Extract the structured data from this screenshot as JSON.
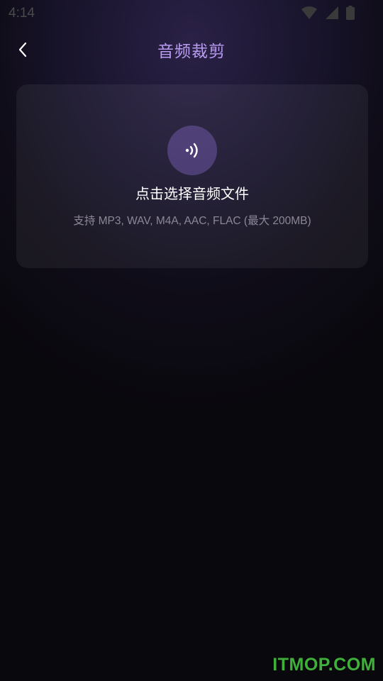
{
  "status_bar": {
    "time": "4:14",
    "icons": [
      "wifi-icon",
      "cell-signal-icon",
      "battery-icon"
    ]
  },
  "header": {
    "back_icon": "chevron-left-icon",
    "title": "音频裁剪"
  },
  "upload": {
    "icon": "audio-wave-icon",
    "title": "点击选择音频文件",
    "subtitle": "支持 MP3, WAV, M4A, AAC, FLAC (最大 200MB)"
  },
  "watermark": "ITMOP.COM",
  "colors": {
    "accent": "#b99cf2",
    "watermark": "#3fb13a"
  }
}
